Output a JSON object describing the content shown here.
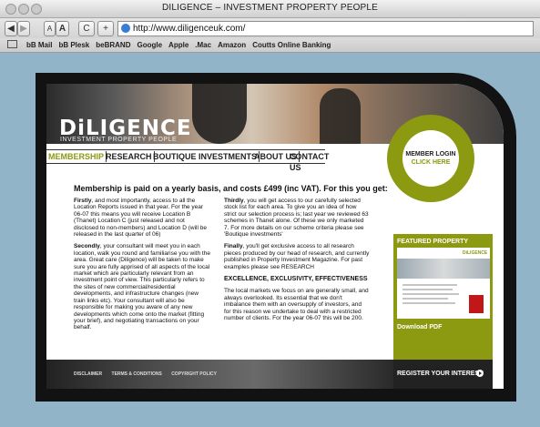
{
  "window": {
    "title": "DILIGENCE – INVESTMENT PROPERTY PEOPLE",
    "url": "http://www.diligenceuk.com/",
    "toolbar": {
      "back": "◀",
      "forward": "▶",
      "text_small": "A",
      "text_large": "A",
      "reload": "C",
      "add": "+"
    }
  },
  "bookmarks": [
    "bB Mail",
    "bB Plesk",
    "beBRAND",
    "Google",
    "Apple",
    ".Mac",
    "Amazon",
    "Coutts Online Banking"
  ],
  "site": {
    "logo": "DiLIGENCE",
    "tagline": "INVESTMENT PROPERTY PEOPLE",
    "nav": [
      "MEMBERSHIP",
      "RESEARCH",
      "BOUTIQUE INVESTMENTS",
      "ABOUT US",
      "CONTACT US"
    ],
    "member_login": {
      "line1": "MEMBER LOGIN",
      "line2": "CLICK HERE"
    },
    "headline": "Membership is paid on a yearly basis, and costs £499 (inc VAT). For this you get:",
    "left_col": [
      {
        "lead": "Firstly",
        "text": ", and most importantly, access to all the Location Reports issued in that year. For the year 06-07 this means you will receive Location B (Thanet) Location C (just released and not disclosed to non-members) and Location D (will be released in the last quarter of 06)"
      },
      {
        "lead": "Secondly",
        "text": ", your consultant will meet you in each location, walk you round and familiarise you with the area. Great care (Diligence) will be taken to make sure you are fully apprised of all aspects of the local market which are particularly relevant from an investment point of view. This particularly refers to the sites of new commercial/residential developments, and infrastructure changes (new train links etc). Your consultant will also be responsible for making you aware of any new developments which come onto the market (fitting your brief), and negotiating transactions on your behalf."
      }
    ],
    "right_col": [
      {
        "lead": "Thirdly",
        "text": ", you will get access to our carefully selected stock list for each area. To give you an idea of how strict our selection process is; last year we reviewed 63 schemes in Thanet alone. Of these we only marketed 7. For more details on our scheme criteria please see 'Boutique investments'"
      },
      {
        "lead": "Finally",
        "text": ", you'll get exclusive access to all research pieces produced by our head of research, and currently published in Property Investment Magazine. For past examples please see RESEARCH"
      }
    ],
    "right_heading": "EXCELLENCE, EXCLUSIVITY, EFFECTIVENESS",
    "right_para": "The local markets we focus on are generally small, and always overlooked. Its essential that we don't imbalance them with an oversupply of investors, and for this reason we undertake to deal with a restricted number of clients. For the year 06-07 this will be 200.",
    "featured": {
      "title": "FEATURED PROPERTY",
      "thumb_logo": "DiLIGENCE",
      "download": "Download PDF"
    },
    "footer_links": [
      "DISCLAIMER",
      "TERMS & CONDITIONS",
      "COPYRIGHT POLICY"
    ],
    "register": "REGISTER YOUR INTEREST"
  }
}
